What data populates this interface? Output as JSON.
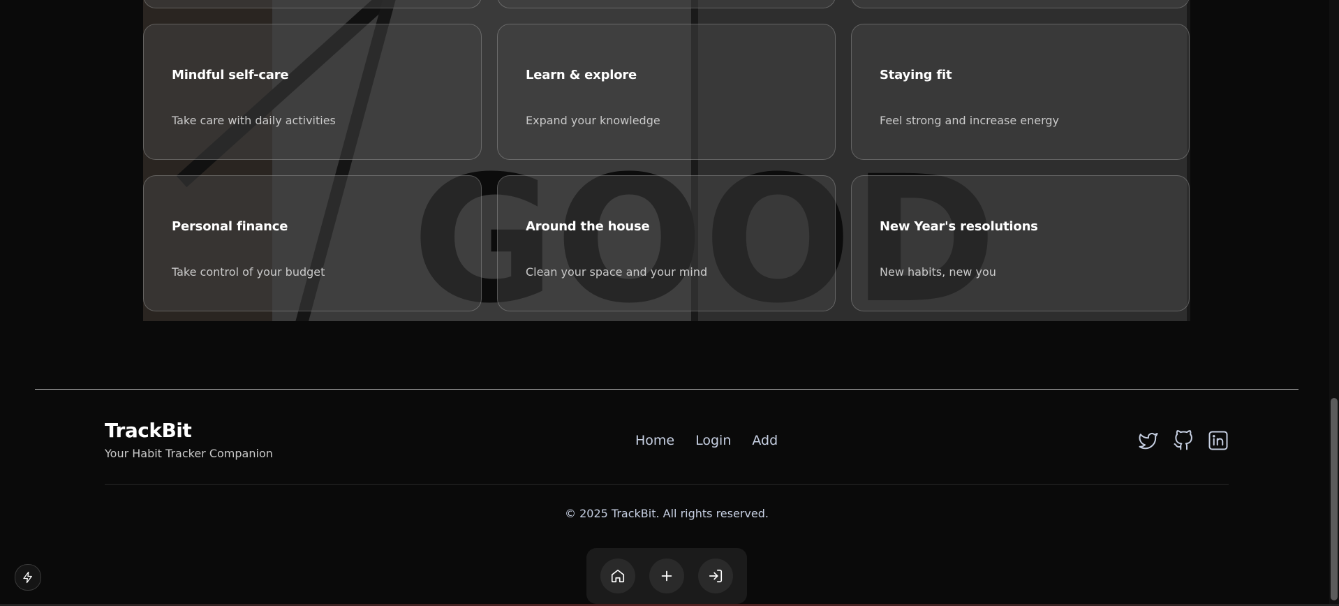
{
  "cards": [
    {
      "title": "Mindful self-care",
      "desc": "Take care with daily activities"
    },
    {
      "title": "Learn & explore",
      "desc": "Expand your knowledge"
    },
    {
      "title": "Staying fit",
      "desc": "Feel strong and increase energy"
    },
    {
      "title": "Personal finance",
      "desc": "Take control of your budget"
    },
    {
      "title": "Around the house",
      "desc": "Clean your space and your mind"
    },
    {
      "title": "New Year's resolutions",
      "desc": "New habits, new you"
    }
  ],
  "footer": {
    "brand": "TrackBit",
    "tagline": "Your Habit Tracker Companion",
    "nav": [
      "Home",
      "Login",
      "Add"
    ],
    "social_icons": [
      "twitter-icon",
      "github-icon",
      "linkedin-icon"
    ],
    "copyright": "© 2025 TrackBit. All rights reserved."
  },
  "dock": {
    "icons": [
      "home-icon",
      "plus-icon",
      "login-icon"
    ]
  },
  "floating_icon": "bolt-icon"
}
